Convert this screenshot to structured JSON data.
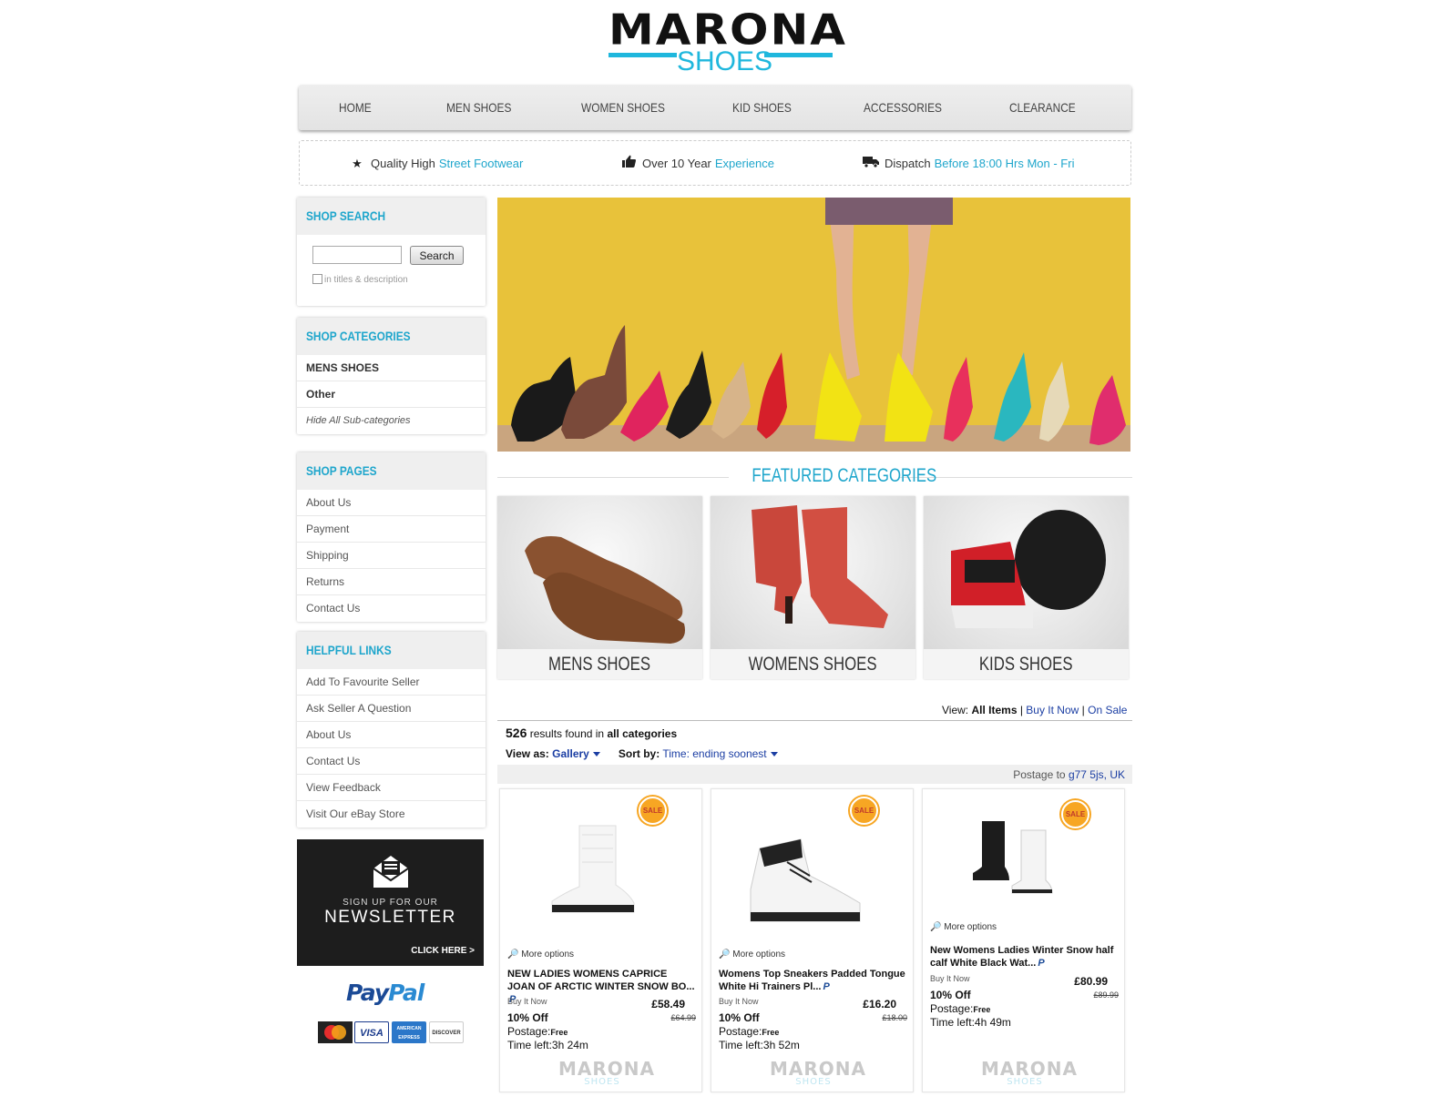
{
  "logo": {
    "line1": "MARONA",
    "line2": "SHOES"
  },
  "nav": [
    "HOME",
    "MEN SHOES",
    "WOMEN SHOES",
    "KID SHOES",
    "ACCESSORIES",
    "CLEARANCE"
  ],
  "features": [
    {
      "icon": "star-icon",
      "dark": "Quality High",
      "blue": "Street Footwear"
    },
    {
      "icon": "thumbs-up-icon",
      "dark": "Over 10 Year",
      "blue": "Experience"
    },
    {
      "icon": "truck-icon",
      "dark": "Dispatch",
      "blue": "Before 18:00 Hrs Mon - Fri"
    }
  ],
  "sidebar": {
    "search": {
      "title": "SHOP SEARCH",
      "button": "Search",
      "checkbox_label": "in titles & description"
    },
    "categories": {
      "title": "SHOP CATEGORIES",
      "items": [
        "MENS SHOES",
        "Other",
        "Hide All Sub-categories"
      ]
    },
    "pages": {
      "title": "SHOP PAGES",
      "items": [
        "About Us",
        "Payment",
        "Shipping",
        "Returns",
        "Contact Us"
      ]
    },
    "links": {
      "title": "HELPFUL LINKS",
      "items": [
        "Add To Favourite Seller",
        "Ask Seller A Question",
        "About Us",
        "Contact Us",
        "View Feedback",
        "Visit Our eBay Store"
      ]
    },
    "newsletter": {
      "small": "SIGN UP FOR OUR",
      "big": "NEWSLETTER",
      "cta": "CLICK HERE >"
    },
    "paypal": {
      "pay": "Pay",
      "pal": "Pal"
    },
    "cards": [
      "MasterCard",
      "VISA",
      "AMERICAN EXPRESS",
      "DISCOVER"
    ]
  },
  "featured": {
    "title": "FEATURED CATEGORIES",
    "categories": [
      "MENS SHOES",
      "WOMENS SHOES",
      "KIDS SHOES"
    ]
  },
  "results": {
    "view_label": "View:",
    "view_all": "All Items",
    "view_bin": "Buy It Now",
    "view_sale": "On Sale",
    "count": "526",
    "found_text": "results found in",
    "found_cat": "all categories",
    "view_as_label": "View as:",
    "view_as_value": "Gallery",
    "sort_label": "Sort by:",
    "sort_value": "Time: ending soonest",
    "postage_label": "Postage to",
    "postage_location": "g77 5js, UK"
  },
  "products": [
    {
      "sale": "SALE",
      "more": "More options",
      "title": "NEW LADIES WOMENS CAPRICE JOAN OF ARCTIC WINTER SNOW BO...",
      "bin": "Buy It Now",
      "price": "£58.49",
      "was": "£64.99",
      "off": "10% Off",
      "postage_label": "Postage:",
      "postage": "Free",
      "time": "Time left:3h 24m"
    },
    {
      "sale": "SALE",
      "more": "More options",
      "title": "Womens Top Sneakers Padded Tongue White Hi Trainers Pl...",
      "bin": "Buy It Now",
      "price": "£16.20",
      "was": "£18.00",
      "off": "10% Off",
      "postage_label": "Postage:",
      "postage": "Free",
      "time": "Time left:3h 52m"
    },
    {
      "sale": "SALE",
      "more": "More options",
      "title": "New Womens Ladies Winter Snow half calf White Black Wat...",
      "bin": "Buy It Now",
      "price": "£80.99",
      "was": "£89.99",
      "off": "10% Off",
      "postage_label": "Postage:",
      "postage": "Free",
      "time": "Time left:4h 49m"
    }
  ],
  "paypal_badge": "P",
  "watermark": {
    "line1": "MARONA",
    "line2": "SHOES"
  },
  "colors": {
    "accent": "#1fa6cc",
    "link": "#1b3ea3",
    "sale": "#f7a623"
  }
}
